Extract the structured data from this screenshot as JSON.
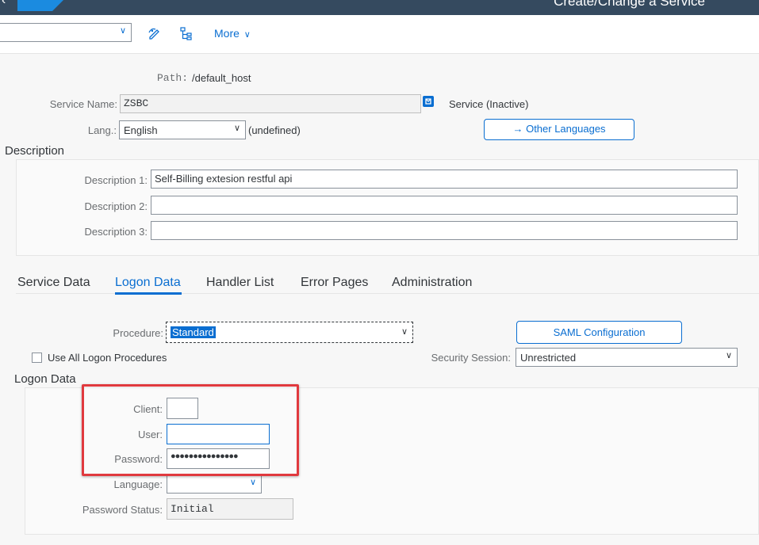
{
  "shell": {
    "title": "Create/Change a Service"
  },
  "toolbar": {
    "command_value": "",
    "more_label": "More"
  },
  "header": {
    "path_label": "Path:",
    "path_value": "/default_host",
    "service_name_label": "Service Name:",
    "service_name_value": "ZSBC",
    "service_status": "Service (Inactive)",
    "lang_label": "Lang.:",
    "lang_value": "English",
    "lang_note": "(undefined)",
    "other_languages_label": "Other Languages"
  },
  "description": {
    "title": "Description",
    "fields": [
      {
        "label": "Description 1:",
        "value": "Self-Billing extesion restful api"
      },
      {
        "label": "Description 2:",
        "value": ""
      },
      {
        "label": "Description 3:",
        "value": ""
      }
    ]
  },
  "tabs": [
    {
      "label": "Service Data",
      "active": false
    },
    {
      "label": "Logon Data",
      "active": true
    },
    {
      "label": "Handler List",
      "active": false
    },
    {
      "label": "Error Pages",
      "active": false
    },
    {
      "label": "Administration",
      "active": false
    }
  ],
  "logon": {
    "procedure_label": "Procedure:",
    "procedure_value": "Standard",
    "saml_button": "SAML Configuration",
    "use_all_label": "Use All Logon Procedures",
    "use_all_checked": false,
    "security_session_label": "Security Session:",
    "security_session_value": "Unrestricted",
    "group_title": "Logon Data",
    "client_label": "Client:",
    "client_value": "",
    "user_label": "User:",
    "user_value": "",
    "password_label": "Password:",
    "password_value": "●●●●●●●●●●●●●●●",
    "language_label": "Language:",
    "language_value": "",
    "password_status_label": "Password Status:",
    "password_status_value": "Initial"
  },
  "colors": {
    "shell": "#354a5f",
    "accent": "#0a6ed1",
    "highlight": "#e0393e"
  }
}
